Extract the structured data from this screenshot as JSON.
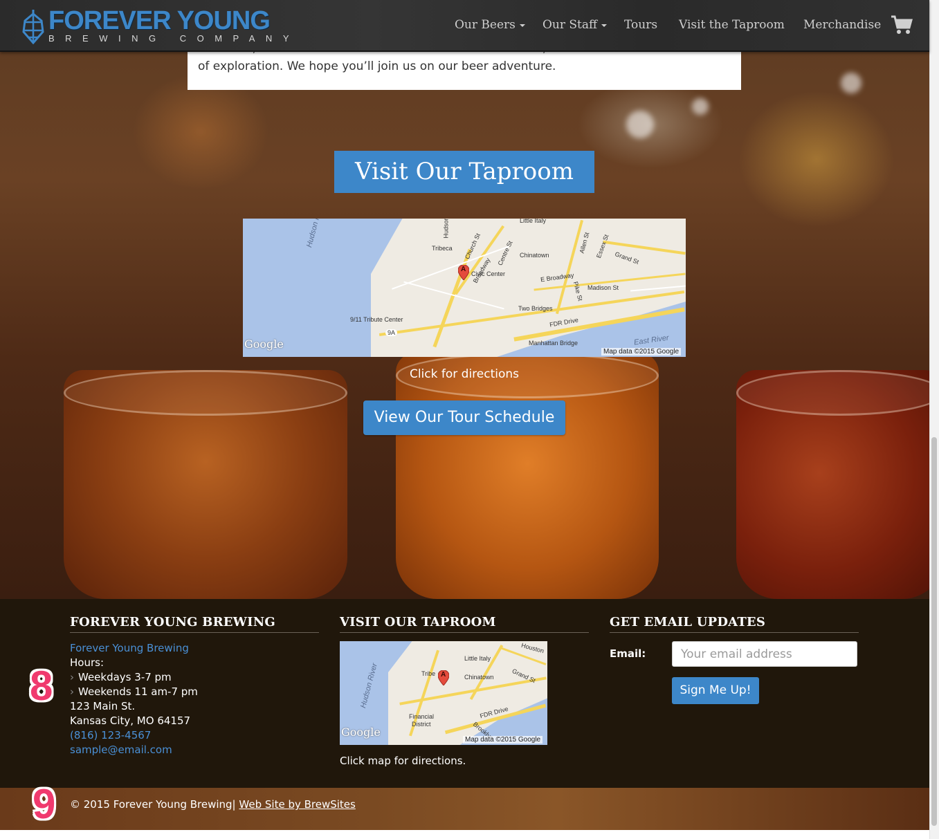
{
  "nav": {
    "logo_main": "FOREVER YOUNG",
    "logo_sub": "BREWING COMPANY",
    "items": [
      {
        "label": "Our Beers",
        "dropdown": true
      },
      {
        "label": "Our Staff",
        "dropdown": true
      },
      {
        "label": "Tours",
        "dropdown": false
      },
      {
        "label": "Visit the Taproom",
        "dropdown": false
      },
      {
        "label": "Merchandise",
        "dropdown": false
      }
    ],
    "cart_icon": "shopping-cart-icon"
  },
  "about": {
    "line1": "Above all, we’re adventurous. We started as homebrewers, and we’ve never lost that sense",
    "line2": "of exploration. We hope you’ll join us on our beer adventure."
  },
  "taproom": {
    "title": "Visit Our Taproom",
    "map": {
      "labels": [
        "Tribeca",
        "Church St",
        "Broadway",
        "Centre St",
        "Little Italy",
        "Chinatown",
        "Allen St",
        "Essex St",
        "Grand St",
        "Civic Center",
        "E Broadway",
        "Madison St",
        "Pike St",
        "Two Bridges",
        "9/11 Tribute Center",
        "FDR Drive",
        "Manhattan Bridge",
        "Hudson",
        "9A"
      ],
      "water_labels": [
        "Hudson River",
        "East River"
      ],
      "marker": "A",
      "google": "Google",
      "attribution": "Map data ©2015 Google"
    },
    "directions_caption": "Click for directions",
    "tour_button": "View Our Tour Schedule"
  },
  "footer": {
    "col1": {
      "title": "FOREVER YOUNG BREWING",
      "name_link": "Forever Young Brewing",
      "hours_label": "Hours:",
      "hours": [
        "Weekdays 3-7 pm",
        "Weekends 11 am-7 pm"
      ],
      "address1": "123 Main St.",
      "address2": "Kansas City, MO 64157",
      "phone": "(816) 123-4567",
      "email": "sample@email.com"
    },
    "col2": {
      "title": "VISIT OUR TAPROOM",
      "map": {
        "labels": [
          "Little Italy",
          "Tribe",
          "Chinatown",
          "Grand St",
          "Houston",
          "Financial",
          "District",
          "FDR Drive",
          "Brooklyn"
        ],
        "water_labels": [
          "Hudson River"
        ],
        "marker": "A",
        "google": "Google",
        "attribution": "Map data ©2015 Google"
      },
      "caption": "Click map for directions."
    },
    "col3": {
      "title": "GET EMAIL UPDATES",
      "email_label": "Email:",
      "email_placeholder": "Your email address",
      "signup_button": "Sign Me Up!"
    },
    "badges": [
      "8",
      "9"
    ],
    "copyright_text": "© 2015 Forever Young Brewing|",
    "credit_link": "Web Site by BrewSites"
  },
  "colors": {
    "accent": "#3d87c9",
    "footer_bg": "#20170b",
    "badge": "#f03a6e"
  }
}
